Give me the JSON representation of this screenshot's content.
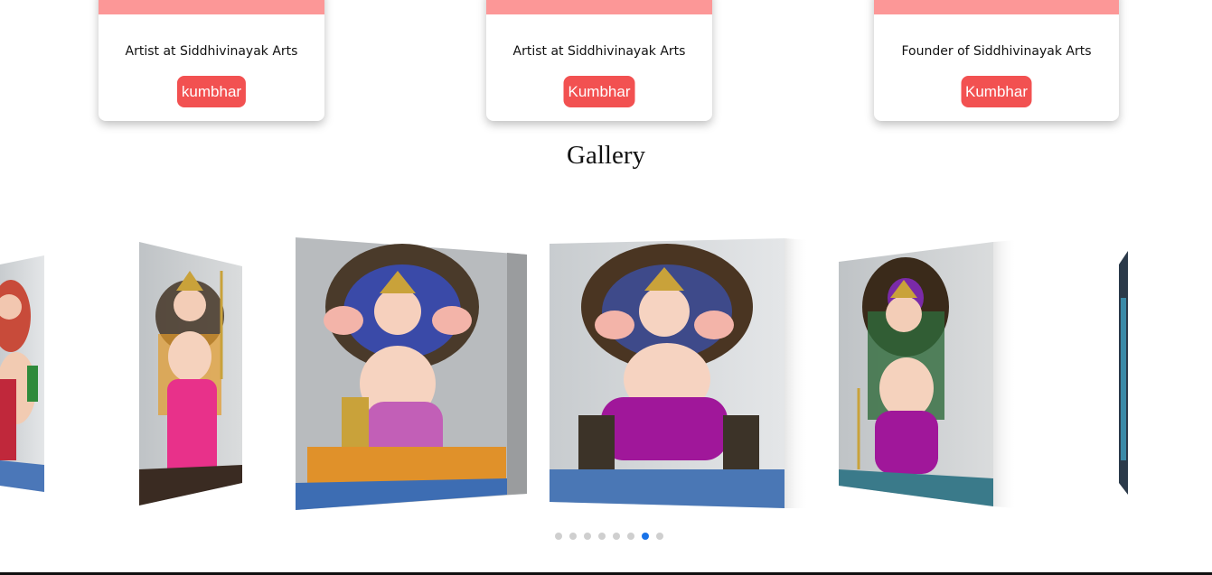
{
  "team_cards": [
    {
      "role": "Artist at Siddhivinayak Arts",
      "button": "kumbhar"
    },
    {
      "role": "Artist at Siddhivinayak Arts",
      "button": "Kumbhar"
    },
    {
      "role": "Founder of Siddhivinayak Arts",
      "button": "Kumbhar"
    }
  ],
  "gallery": {
    "title": "Gallery",
    "slide_count": 8,
    "active_index": 6
  },
  "colors": {
    "card_band": "#fc9797",
    "button": "#f25151",
    "active_dot": "#1a73e8",
    "inactive_dot": "#cfcfcf"
  }
}
